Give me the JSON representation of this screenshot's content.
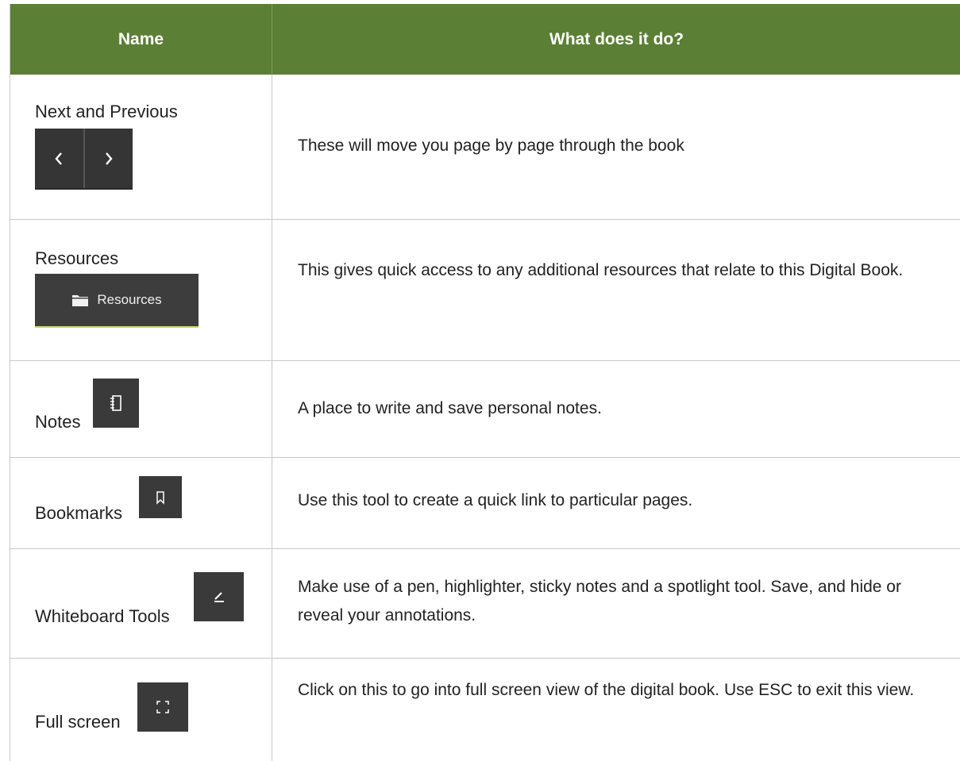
{
  "table": {
    "headers": {
      "name": "Name",
      "description": "What does it do?"
    },
    "rows": [
      {
        "name": "Next and Previous",
        "description": "These will move you page by page through the book",
        "icon": "prev-next-arrows"
      },
      {
        "name": "Resources",
        "description": "This gives quick access to any additional resources that relate to this Digital Book.",
        "button_label": "Resources",
        "icon": "folder-icon"
      },
      {
        "name": "Notes",
        "description": "A place to write and save personal notes.",
        "icon": "notebook-icon"
      },
      {
        "name": "Bookmarks",
        "description": "Use this tool to create a quick link to particular pages.",
        "icon": "bookmark-icon"
      },
      {
        "name": "Whiteboard Tools",
        "description": "Make use of a pen, highlighter, sticky notes and a spotlight tool. Save, and hide or reveal your annotations.",
        "icon": "pen-icon"
      },
      {
        "name": "Full screen",
        "description": "Click on this to go into full screen view of the digital book. Use ESC to exit this view.",
        "icon": "fullscreen-icon"
      }
    ]
  },
  "colors": {
    "header_bg": "#5b7f34",
    "header_text": "#ffffff",
    "button_bg": "#3a3a3a",
    "border": "#c8c8c8"
  }
}
